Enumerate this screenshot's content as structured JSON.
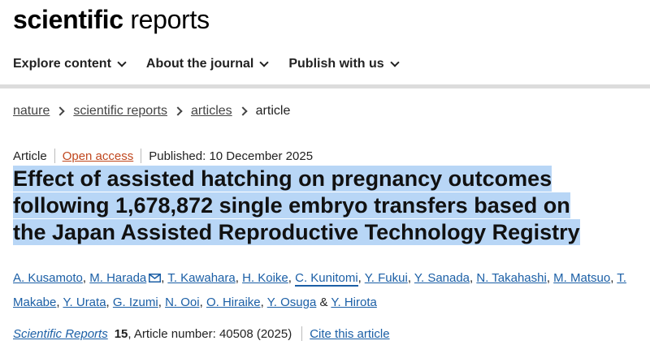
{
  "brand": {
    "bold": "scientific",
    "light": " reports"
  },
  "nav": {
    "items": [
      {
        "label": "Explore content"
      },
      {
        "label": "About the journal"
      },
      {
        "label": "Publish with us"
      }
    ]
  },
  "breadcrumb": {
    "items": [
      "nature",
      "scientific reports",
      "articles"
    ],
    "current": "article"
  },
  "meta": {
    "type": "Article",
    "access": "Open access",
    "published": "Published: 10 December 2025"
  },
  "title": {
    "line1": "Effect of assisted hatching on pregnancy outcomes",
    "line2": "following 1,678,872 single embryo transfers based on",
    "line3": "the Japan Assisted Reproductive Technology Registry"
  },
  "authors": {
    "list": [
      "A. Kusamoto",
      "M. Harada",
      "T. Kawahara",
      "H. Koike",
      "C. Kunitomi",
      "Y. Fukui",
      "Y. Sanada",
      "N. Takahashi",
      "M. Matsuo",
      "T. Makabe",
      "Y. Urata",
      "G. Izumi",
      "N. Ooi",
      "O. Hiraike",
      "Y. Osuga",
      "Y. Hirota"
    ],
    "and": "&"
  },
  "citation": {
    "journal": "Scientific Reports",
    "volume": "15",
    "article_number": ", Article number: 40508 (2025)",
    "cite_label": "Cite this article"
  },
  "colors": {
    "link": "#1b5fa6",
    "open_access": "#c0471e",
    "title_highlight": "#b8d6f6"
  }
}
